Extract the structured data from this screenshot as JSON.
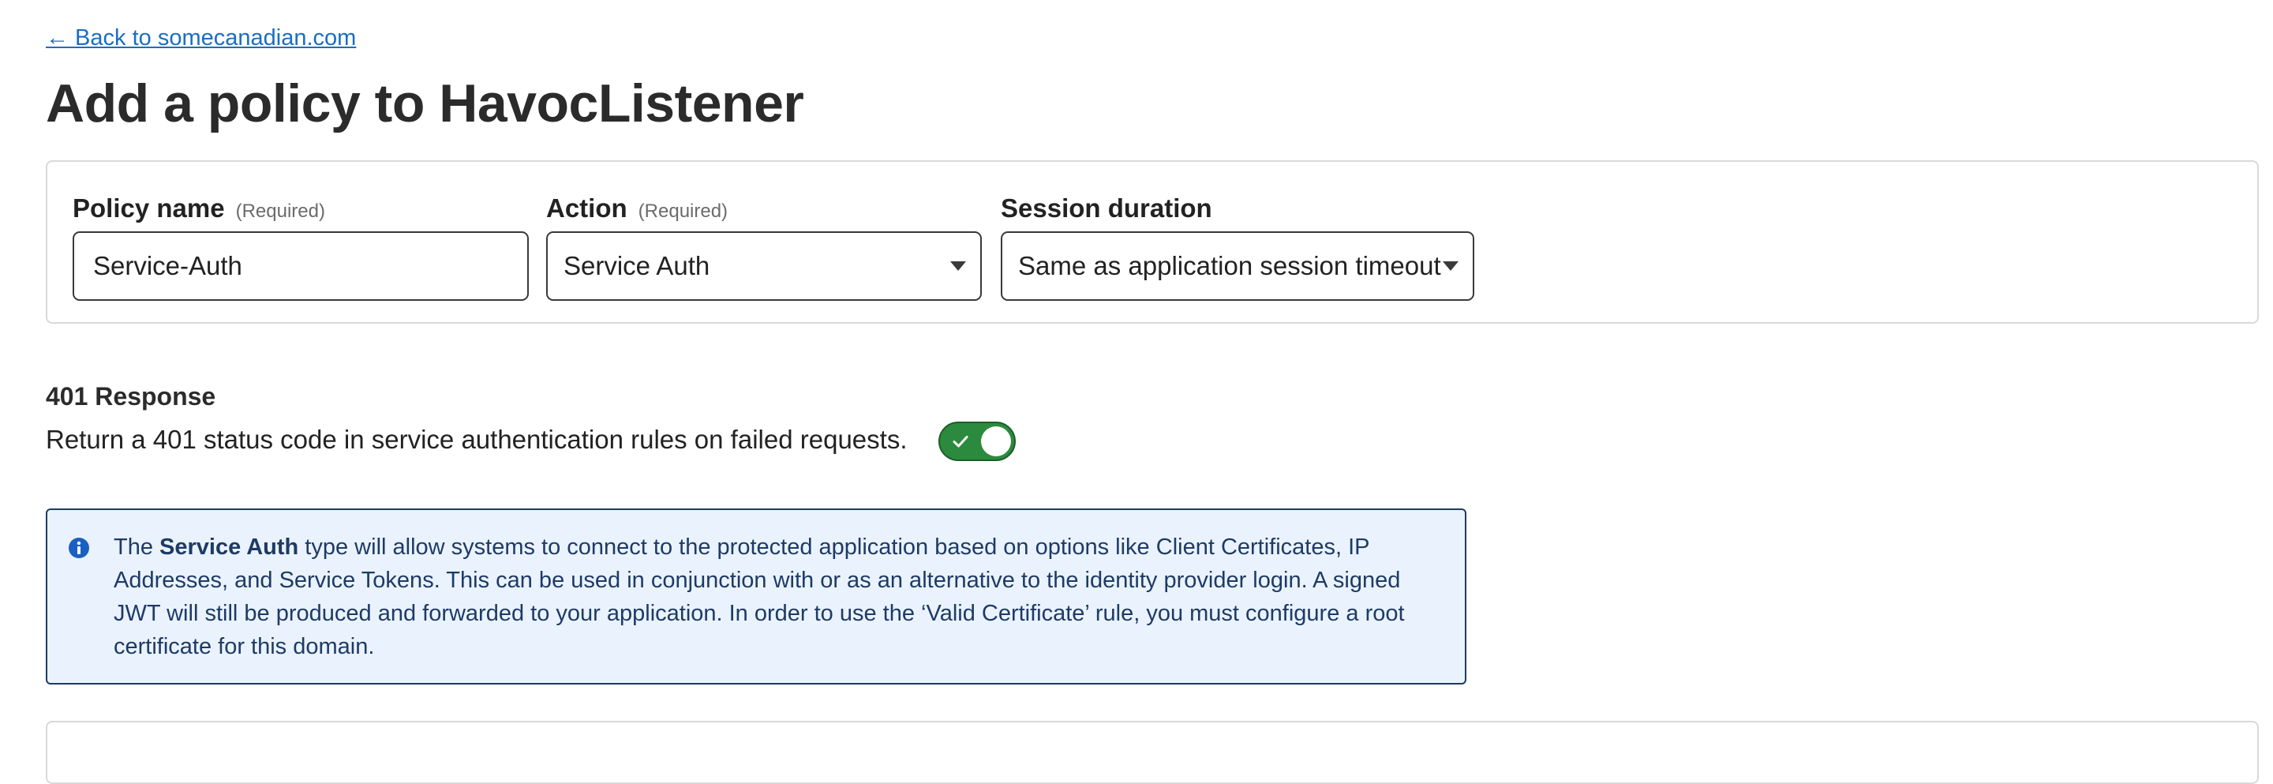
{
  "back_link": {
    "label": "← Back to somecanadian.com"
  },
  "page_title": "Add a policy to HavocListener",
  "policy_form": {
    "policy_name": {
      "label": "Policy name",
      "required_hint": "(Required)",
      "value": "Service-Auth"
    },
    "action": {
      "label": "Action",
      "required_hint": "(Required)",
      "selected": "Service Auth"
    },
    "session_duration": {
      "label": "Session duration",
      "selected": "Same as application session timeout"
    }
  },
  "response_401": {
    "heading": "401 Response",
    "description": "Return a 401 status code in service authentication rules on failed requests.",
    "toggle_on": true
  },
  "info_box": {
    "prefix": "The ",
    "bold": "Service Auth",
    "body": " type will allow systems to connect to the protected application based on options like Client Certificates, IP Addresses, and Service Tokens. This can be used in conjunction with or as an alternative to the identity provider login. A signed JWT will still be produced and forwarded to your application. In order to use the ‘Valid Certificate’ rule, you must configure a root certificate for this domain."
  },
  "colors": {
    "link": "#1a6ec2",
    "toggle_on": "#2b8a3e",
    "info_background": "#eaf3fd",
    "info_border": "#1e3a66",
    "info_icon": "#1a5fc2"
  },
  "icons": {
    "back_arrow": "left-arrow",
    "select_caret": "caret-down-icon",
    "toggle_check": "check-icon",
    "info": "info-icon"
  }
}
